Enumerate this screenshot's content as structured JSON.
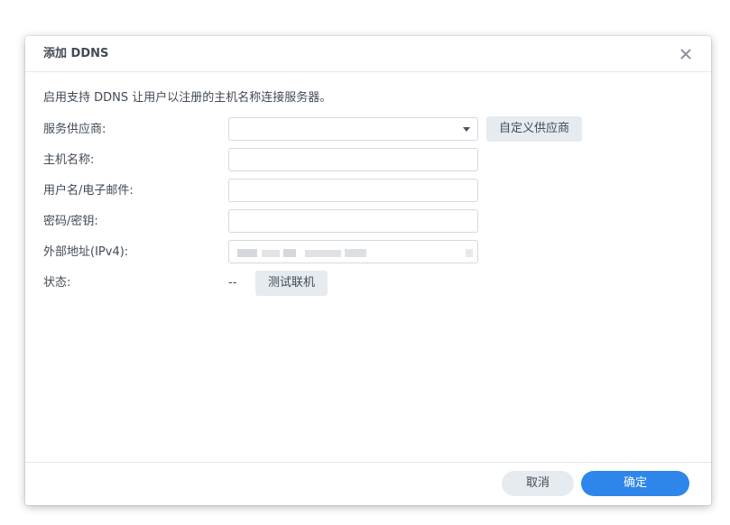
{
  "dialog": {
    "title": "添加 DDNS",
    "description": "启用支持 DDNS 让用户以注册的主机名称连接服务器。"
  },
  "form": {
    "provider_label": "服务供应商:",
    "provider_value": "",
    "custom_provider_button": "自定义供应商",
    "hostname_label": "主机名称:",
    "hostname_value": "",
    "username_label": "用户名/电子邮件:",
    "username_value": "",
    "password_label": "密码/密钥:",
    "password_value": "",
    "external_address_label": "外部地址(IPv4):",
    "status_label": "状态:",
    "status_value": "--",
    "test_connection_button": "测试联机"
  },
  "footer": {
    "cancel_label": "取消",
    "ok_label": "确定"
  },
  "colors": {
    "primary": "#2f86ea",
    "secondary_button": "#e6ebf0",
    "text": "#414b55",
    "border": "#d4d9de"
  },
  "icons": {
    "close": "close-icon",
    "dropdown": "chevron-down-icon"
  }
}
